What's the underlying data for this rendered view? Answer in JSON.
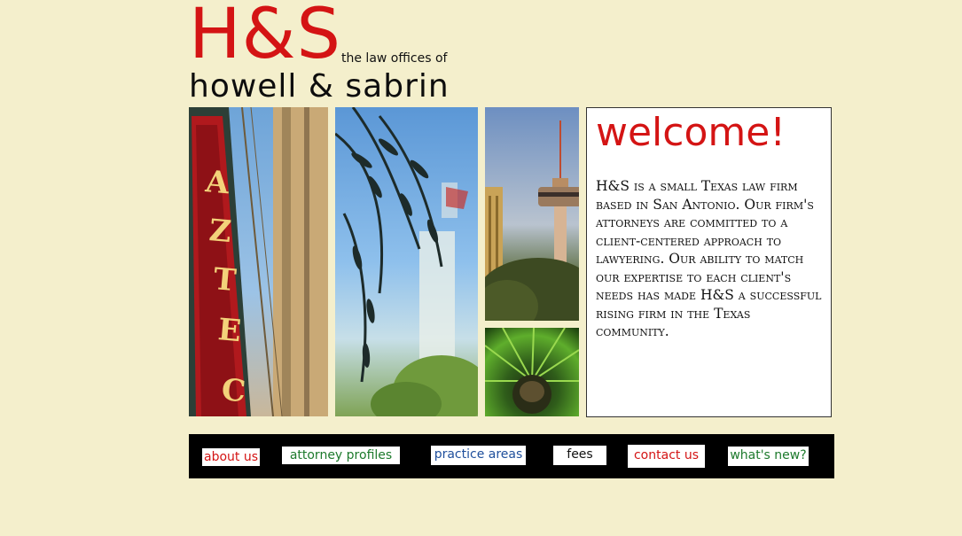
{
  "header": {
    "logo_initials": "H&S",
    "logo_subtitle": "the law offices of",
    "logo_name": "howell & sabrin"
  },
  "photos": [
    {
      "name": "aztec-theater-sign-photo",
      "caption": "AZTEC"
    },
    {
      "name": "palm-fronds-sky-photo"
    },
    {
      "name": "tower-of-americas-photo"
    },
    {
      "name": "palm-tree-night-photo"
    }
  ],
  "welcome": {
    "title": "welcome!",
    "body": "H&S is a small Texas law firm based in San Antonio. Our firm's attorneys are committed to a client-centered approach to lawyering. Our ability to match our expertise to each client's needs has made H&S a successful rising firm in the Texas community."
  },
  "nav": {
    "about": "about us",
    "attorney": "attorney profiles",
    "practice": "practice areas",
    "fees": "fees",
    "contact": "contact us",
    "news": "what's new?"
  },
  "colors": {
    "background": "#f4efcc",
    "accent_red": "#d41414",
    "nav_green": "#1d7a2c",
    "nav_blue": "#1f4f9c",
    "navbar": "#000000"
  }
}
